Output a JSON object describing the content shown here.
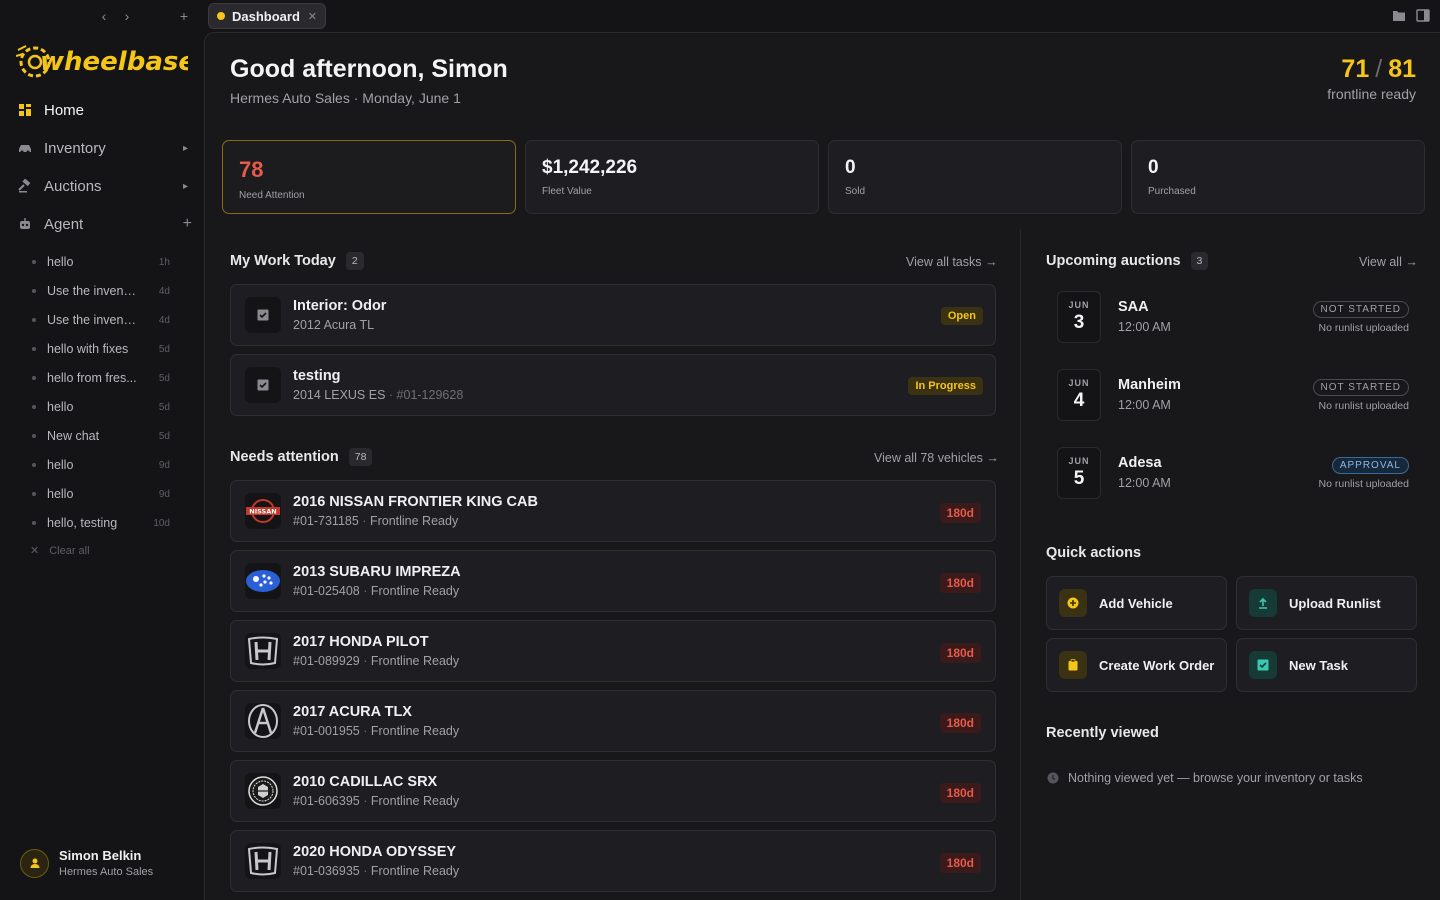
{
  "tab": {
    "label": "Dashboard"
  },
  "sidebar": {
    "brand": "wheelbase",
    "nav": [
      {
        "label": "Home"
      },
      {
        "label": "Inventory"
      },
      {
        "label": "Auctions"
      },
      {
        "label": "Agent"
      }
    ],
    "chats": [
      {
        "label": "hello",
        "time": "1h"
      },
      {
        "label": "Use the invent...",
        "time": "4d"
      },
      {
        "label": "Use the invent...",
        "time": "4d"
      },
      {
        "label": "hello with fixes",
        "time": "5d"
      },
      {
        "label": "hello from fres...",
        "time": "5d"
      },
      {
        "label": "hello",
        "time": "5d"
      },
      {
        "label": "New chat",
        "time": "5d"
      },
      {
        "label": "hello",
        "time": "9d"
      },
      {
        "label": "hello",
        "time": "9d"
      },
      {
        "label": "hello, testing",
        "time": "10d"
      }
    ],
    "clear_all": "Clear all",
    "user": {
      "name": "Simon Belkin",
      "org": "Hermes Auto Sales"
    }
  },
  "header": {
    "greeting": "Good afternoon, Simon",
    "subtitle": "Hermes Auto Sales · Monday, June 1",
    "ready_count": "71",
    "ready_total": "81",
    "ready_label": "frontline ready"
  },
  "stats": [
    {
      "value": "78",
      "label": "Need Attention"
    },
    {
      "value": "$1,242,226",
      "label": "Fleet Value"
    },
    {
      "value": "0",
      "label": "Sold"
    },
    {
      "value": "0",
      "label": "Purchased"
    }
  ],
  "work": {
    "title": "My Work Today",
    "count": "2",
    "link": "View all tasks →",
    "items": [
      {
        "title": "Interior: Odor",
        "sub": "2012 Acura TL",
        "ref": "",
        "status": "Open"
      },
      {
        "title": "testing",
        "sub": "2014 LEXUS ES",
        "ref": "· #01-129628",
        "status": "In Progress"
      }
    ]
  },
  "attention": {
    "title": "Needs attention",
    "count": "78",
    "link": "View all 78 vehicles →",
    "items": [
      {
        "title": "2016 NISSAN FRONTIER KING CAB",
        "stock": "#01-731185",
        "status": "Frontline Ready",
        "days": "180d",
        "logo": "NISSAN"
      },
      {
        "title": "2013 SUBARU IMPREZA",
        "stock": "#01-025408",
        "status": "Frontline Ready",
        "days": "180d",
        "logo": "subaru"
      },
      {
        "title": "2017 HONDA PILOT",
        "stock": "#01-089929",
        "status": "Frontline Ready",
        "days": "180d",
        "logo": "honda"
      },
      {
        "title": "2017 ACURA TLX",
        "stock": "#01-001955",
        "status": "Frontline Ready",
        "days": "180d",
        "logo": "acura"
      },
      {
        "title": "2010 CADILLAC SRX",
        "stock": "#01-606395",
        "status": "Frontline Ready",
        "days": "180d",
        "logo": "cadillac"
      },
      {
        "title": "2020 HONDA ODYSSEY",
        "stock": "#01-036935",
        "status": "Frontline Ready",
        "days": "180d",
        "logo": "honda"
      }
    ]
  },
  "auctions": {
    "title": "Upcoming auctions",
    "count": "3",
    "link": "View all →",
    "items": [
      {
        "month": "JUN",
        "day": "3",
        "name": "SAA",
        "time": "12:00 AM",
        "status": "NOT STARTED",
        "note": "No runlist uploaded"
      },
      {
        "month": "JUN",
        "day": "4",
        "name": "Manheim",
        "time": "12:00 AM",
        "status": "NOT STARTED",
        "note": "No runlist uploaded"
      },
      {
        "month": "JUN",
        "day": "5",
        "name": "Adesa",
        "time": "12:00 AM",
        "status": "APPROVAL",
        "note": "No runlist uploaded"
      }
    ]
  },
  "quick_actions": {
    "title": "Quick actions",
    "items": [
      {
        "label": "Add Vehicle"
      },
      {
        "label": "Upload Runlist"
      },
      {
        "label": "Create Work Order"
      },
      {
        "label": "New Task"
      }
    ]
  },
  "recent": {
    "title": "Recently viewed",
    "empty": "Nothing viewed yet — browse your inventory or tasks"
  },
  "colors": {
    "accent": "#f5c518",
    "danger": "#e85a4a",
    "bg": "#141416",
    "panel": "#18181b"
  }
}
